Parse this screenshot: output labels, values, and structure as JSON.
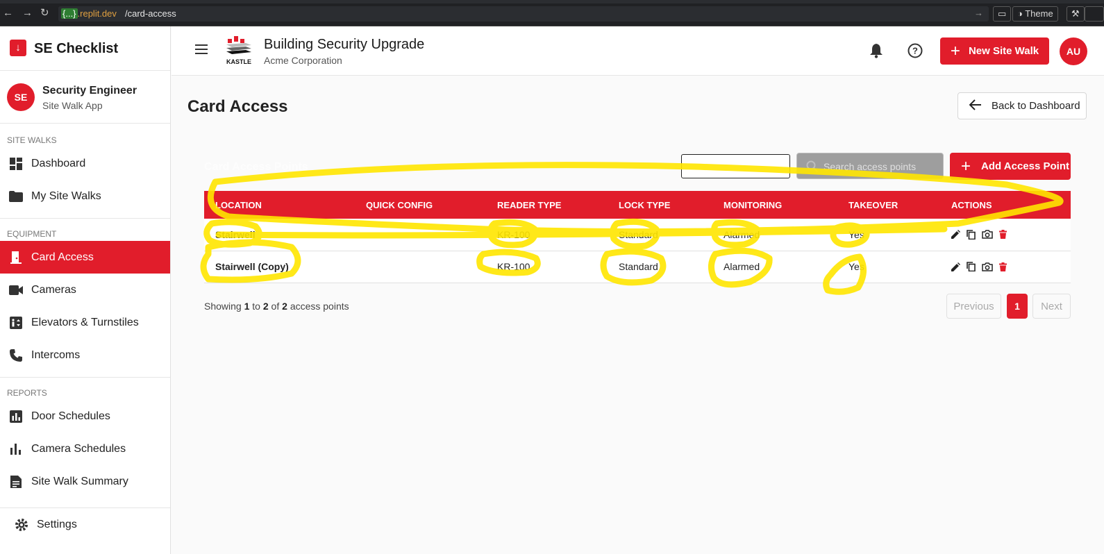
{
  "browser": {
    "host_brace": "{...}",
    "host_rest": ".replit.dev",
    "path": "/card-access",
    "theme_label": "Theme"
  },
  "sidebar": {
    "brand": "SE Checklist",
    "user": {
      "initials": "SE",
      "name": "Security Engineer",
      "subtitle": "Site Walk App"
    },
    "sections": [
      {
        "label": "SITE WALKS",
        "items": [
          {
            "label": "Dashboard",
            "icon": "dashboard-icon"
          },
          {
            "label": "My Site Walks",
            "icon": "folder-icon"
          }
        ]
      },
      {
        "label": "EQUIPMENT",
        "items": [
          {
            "label": "Card Access",
            "icon": "door-icon",
            "active": true
          },
          {
            "label": "Cameras",
            "icon": "videocam-icon"
          },
          {
            "label": "Elevators & Turnstiles",
            "icon": "elevator-icon"
          },
          {
            "label": "Intercoms",
            "icon": "phone-icon"
          }
        ]
      },
      {
        "label": "REPORTS",
        "items": [
          {
            "label": "Door Schedules",
            "icon": "bar-chart-icon"
          },
          {
            "label": "Camera Schedules",
            "icon": "bar-chart-icon"
          },
          {
            "label": "Site Walk Summary",
            "icon": "summary-icon"
          }
        ]
      }
    ],
    "settings_label": "Settings"
  },
  "header": {
    "logo_text": "KASTLE",
    "project_title": "Building Security Upgrade",
    "project_client": "Acme Corporation",
    "new_walk_label": "New Site Walk",
    "avatar_initials": "AU"
  },
  "main": {
    "page_title": "Card Access",
    "back_label": "Back to Dashboard",
    "card_title": "Card Access Points",
    "search_placeholder": "Search access points",
    "add_label": "Add Access Point",
    "columns": [
      "LOCATION",
      "QUICK CONFIG",
      "READER TYPE",
      "LOCK TYPE",
      "MONITORING",
      "TAKEOVER",
      "ACTIONS"
    ],
    "rows": [
      {
        "location": "Stairwell",
        "quick_config": "",
        "reader_type": "KR-100",
        "lock_type": "Standard",
        "monitoring": "Alarmed",
        "takeover": "Yes"
      },
      {
        "location": "Stairwell (Copy)",
        "quick_config": "",
        "reader_type": "KR-100",
        "lock_type": "Standard",
        "monitoring": "Alarmed",
        "takeover": "Yes"
      }
    ],
    "showing": {
      "prefix": "Showing",
      "from": "1",
      "to_word": "to",
      "to": "2",
      "of_word": "of",
      "total": "2",
      "suffix": "access points"
    },
    "pager": {
      "previous": "Previous",
      "current": "1",
      "next": "Next"
    }
  },
  "colors": {
    "accent": "#e11d2b",
    "annotation": "#ffe600"
  }
}
